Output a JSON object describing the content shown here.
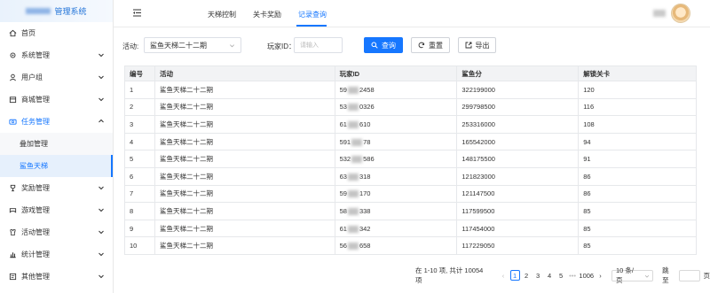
{
  "brand": {
    "title": "管理系统"
  },
  "sidebar": {
    "items": [
      {
        "label": "首页",
        "icon": "home-icon"
      },
      {
        "label": "系统管理",
        "icon": "gear-icon"
      },
      {
        "label": "用户组",
        "icon": "user-icon"
      },
      {
        "label": "商城管理",
        "icon": "shop-icon"
      },
      {
        "label": "任务管理",
        "icon": "task-icon"
      },
      {
        "label": "叠加管理"
      },
      {
        "label": "鲨鱼天梯"
      },
      {
        "label": "奖励管理",
        "icon": "trophy-icon"
      },
      {
        "label": "游戏管理",
        "icon": "game-icon"
      },
      {
        "label": "活动管理",
        "icon": "activity-icon"
      },
      {
        "label": "统计管理",
        "icon": "stats-icon"
      },
      {
        "label": "其他管理",
        "icon": "other-icon"
      }
    ]
  },
  "topbar": {
    "tabs": [
      {
        "label": "天梯控制"
      },
      {
        "label": "关卡奖励"
      },
      {
        "label": "记录查询"
      }
    ]
  },
  "filters": {
    "activity_label": "活动:",
    "activity_value": "鲨鱼天梯二十二期",
    "player_label": "玩家ID：",
    "player_placeholder": "请输入",
    "search_label": "查询",
    "reset_label": "重置",
    "export_label": "导出"
  },
  "table": {
    "headers": [
      "编号",
      "活动",
      "玩家ID",
      "鲨鱼分",
      "解锁关卡"
    ],
    "rows": [
      {
        "no": "1",
        "activity": "鲨鱼天梯二十二期",
        "pid_a": "59",
        "pid_b": "2458",
        "score": "322199000",
        "level": "120"
      },
      {
        "no": "2",
        "activity": "鲨鱼天梯二十二期",
        "pid_a": "53",
        "pid_b": "0326",
        "score": "299798500",
        "level": "116"
      },
      {
        "no": "3",
        "activity": "鲨鱼天梯二十二期",
        "pid_a": "61",
        "pid_b": "610",
        "score": "253316000",
        "level": "108"
      },
      {
        "no": "4",
        "activity": "鲨鱼天梯二十二期",
        "pid_a": "591",
        "pid_b": "78",
        "score": "165542000",
        "level": "94"
      },
      {
        "no": "5",
        "activity": "鲨鱼天梯二十二期",
        "pid_a": "532",
        "pid_b": "586",
        "score": "148175500",
        "level": "91"
      },
      {
        "no": "6",
        "activity": "鲨鱼天梯二十二期",
        "pid_a": "63",
        "pid_b": "318",
        "score": "121823000",
        "level": "86"
      },
      {
        "no": "7",
        "activity": "鲨鱼天梯二十二期",
        "pid_a": "59",
        "pid_b": "170",
        "score": "121147500",
        "level": "86"
      },
      {
        "no": "8",
        "activity": "鲨鱼天梯二十二期",
        "pid_a": "58",
        "pid_b": "338",
        "score": "117599500",
        "level": "85"
      },
      {
        "no": "9",
        "activity": "鲨鱼天梯二十二期",
        "pid_a": "61",
        "pid_b": "342",
        "score": "117454000",
        "level": "85"
      },
      {
        "no": "10",
        "activity": "鲨鱼天梯二十二期",
        "pid_a": "56",
        "pid_b": "658",
        "score": "117229050",
        "level": "85"
      }
    ]
  },
  "pagination": {
    "total_text": "在 1-10 项, 共计 10054 项",
    "pages": [
      "1",
      "2",
      "3",
      "4",
      "5",
      "•••",
      "1006"
    ],
    "page_size": "10 条/页",
    "jump_label": "跳至",
    "page_label": "页",
    "prev": "‹",
    "next": "›"
  },
  "colors": {
    "accent": "#1677ff"
  }
}
